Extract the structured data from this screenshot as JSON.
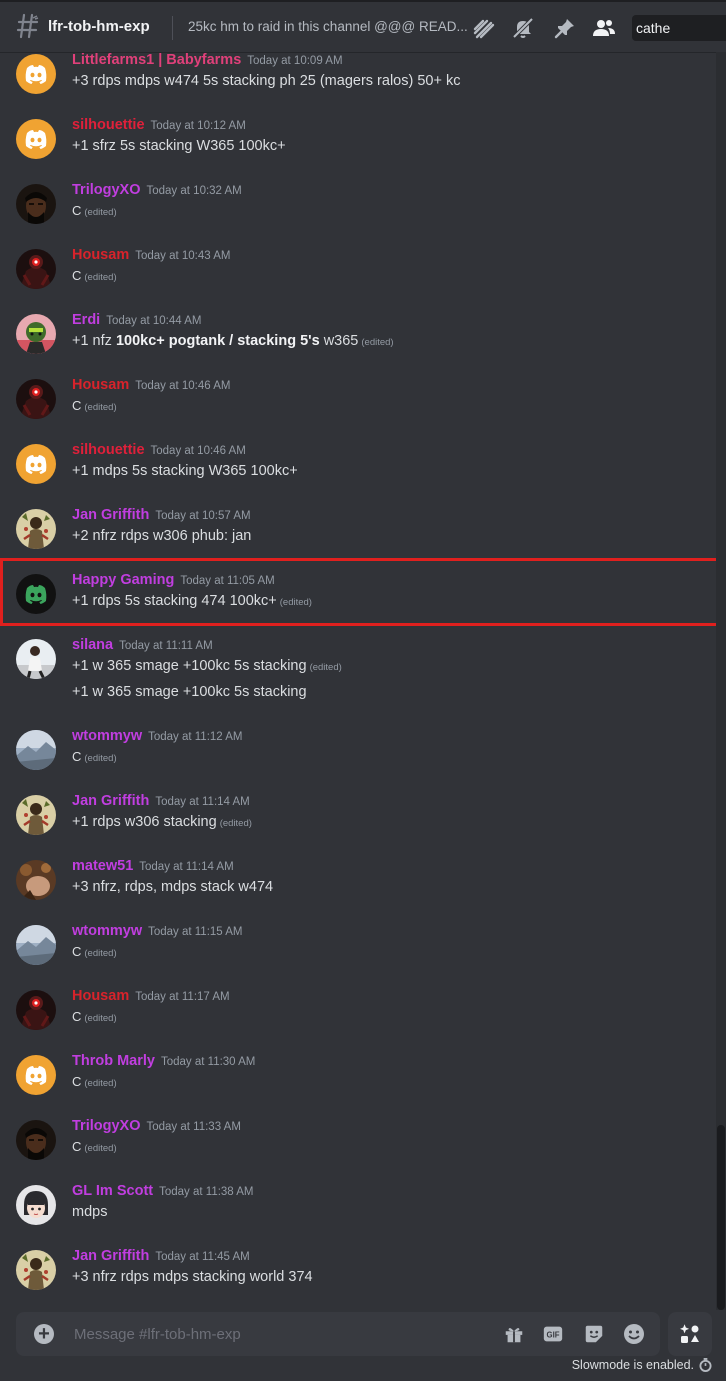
{
  "header": {
    "channel_name": "lfr-tob-hm-exp",
    "topic": "25kc hm to raid in this channel @@@ READ...",
    "search_value": "cathe"
  },
  "messages": [
    {
      "user": "Littlefarms1 | Babyfarms",
      "color": "#e0407a",
      "time": "Today at 10:09 AM",
      "avatar": "discord-orange",
      "lines": [
        {
          "parts": [
            {
              "t": "+3 rdps mdps w474 5s stacking ph 25 (magers ralos) 50+ kc"
            }
          ]
        }
      ]
    },
    {
      "user": "silhouettie",
      "color": "#e0203a",
      "time": "Today at 10:12 AM",
      "avatar": "discord-orange",
      "lines": [
        {
          "parts": [
            {
              "t": "+1 sfrz 5s stacking W365 100kc+"
            }
          ]
        }
      ]
    },
    {
      "user": "TrilogyXO",
      "color": "#c13ee0",
      "time": "Today at 10:32 AM",
      "avatar": "dark-face",
      "lines": [
        {
          "parts": [
            {
              "t": "C",
              "small": true
            }
          ],
          "edited": "(edited)"
        }
      ]
    },
    {
      "user": "Housam",
      "color": "#d8232b",
      "time": "Today at 10:43 AM",
      "avatar": "red-eye",
      "lines": [
        {
          "parts": [
            {
              "t": "C",
              "small": true
            }
          ],
          "edited": "(edited)"
        }
      ]
    },
    {
      "user": "Erdi",
      "color": "#c13ee0",
      "time": "Today at 10:44 AM",
      "avatar": "green-char",
      "lines": [
        {
          "parts": [
            {
              "t": "+1 nfz "
            },
            {
              "t": "100kc+ pogtank / stacking 5's",
              "bold": true
            },
            {
              "t": " w365"
            }
          ],
          "edited": "(edited)"
        }
      ]
    },
    {
      "user": "Housam",
      "color": "#d8232b",
      "time": "Today at 10:46 AM",
      "avatar": "red-eye",
      "lines": [
        {
          "parts": [
            {
              "t": "C",
              "small": true
            }
          ],
          "edited": "(edited)"
        }
      ]
    },
    {
      "user": "silhouettie",
      "color": "#e0203a",
      "time": "Today at 10:46 AM",
      "avatar": "discord-orange",
      "lines": [
        {
          "parts": [
            {
              "t": "+1 mdps 5s stacking W365 100kc+"
            }
          ]
        }
      ]
    },
    {
      "user": "Jan Griffith",
      "color": "#c13ee0",
      "time": "Today at 10:57 AM",
      "avatar": "beige-figure",
      "lines": [
        {
          "parts": [
            {
              "t": "+2 nfrz rdps w306 phub: jan"
            }
          ]
        }
      ]
    },
    {
      "user": "Happy Gaming",
      "color": "#c13ee0",
      "time": "Today at 11:05 AM",
      "avatar": "discord-green",
      "lines": [
        {
          "parts": [
            {
              "t": "+1 rdps 5s stacking 474 100kc+"
            }
          ],
          "edited": "(edited)"
        }
      ]
    },
    {
      "user": "silana",
      "color": "#c13ee0",
      "time": "Today at 11:11 AM",
      "avatar": "person-photo",
      "lines": [
        {
          "parts": [
            {
              "t": "+1 w 365 smage +100kc 5s stacking"
            }
          ],
          "edited": "(edited)"
        },
        {
          "parts": [
            {
              "t": "+1 w 365 smage +100kc 5s stacking"
            }
          ]
        }
      ]
    },
    {
      "user": "wtommyw",
      "color": "#c13ee0",
      "time": "Today at 11:12 AM",
      "avatar": "grey-landscape",
      "lines": [
        {
          "parts": [
            {
              "t": "C",
              "small": true
            }
          ],
          "edited": "(edited)"
        }
      ]
    },
    {
      "user": "Jan Griffith",
      "color": "#c13ee0",
      "time": "Today at 11:14 AM",
      "avatar": "beige-figure",
      "lines": [
        {
          "parts": [
            {
              "t": "+1 rdps w306 stacking"
            }
          ],
          "edited": "(edited)"
        }
      ]
    },
    {
      "user": "matew51",
      "color": "#c13ee0",
      "time": "Today at 11:14 AM",
      "avatar": "brown-photo",
      "lines": [
        {
          "parts": [
            {
              "t": "+3 nfrz, rdps, mdps stack w474"
            }
          ]
        }
      ]
    },
    {
      "user": "wtommyw",
      "color": "#c13ee0",
      "time": "Today at 11:15 AM",
      "avatar": "grey-landscape",
      "lines": [
        {
          "parts": [
            {
              "t": "C",
              "small": true
            }
          ],
          "edited": "(edited)"
        }
      ]
    },
    {
      "user": "Housam",
      "color": "#d8232b",
      "time": "Today at 11:17 AM",
      "avatar": "red-eye",
      "lines": [
        {
          "parts": [
            {
              "t": "C",
              "small": true
            }
          ],
          "edited": "(edited)"
        }
      ]
    },
    {
      "user": "Throb Marly",
      "color": "#c13ee0",
      "time": "Today at 11:30 AM",
      "avatar": "discord-orange",
      "lines": [
        {
          "parts": [
            {
              "t": "C",
              "small": true
            }
          ],
          "edited": "(edited)"
        }
      ]
    },
    {
      "user": "TrilogyXO",
      "color": "#c13ee0",
      "time": "Today at 11:33 AM",
      "avatar": "dark-face",
      "lines": [
        {
          "parts": [
            {
              "t": "C",
              "small": true
            }
          ],
          "edited": "(edited)"
        }
      ]
    },
    {
      "user": "GL Im Scott",
      "color": "#c13ee0",
      "time": "Today at 11:38 AM",
      "avatar": "anime-face",
      "lines": [
        {
          "parts": [
            {
              "t": "mdps"
            }
          ]
        }
      ]
    },
    {
      "user": "Jan Griffith",
      "color": "#c13ee0",
      "time": "Today at 11:45 AM",
      "avatar": "beige-figure",
      "lines": [
        {
          "parts": [
            {
              "t": "+3 nfrz rdps mdps stacking world 374"
            }
          ]
        }
      ]
    }
  ],
  "composer": {
    "placeholder": "Message #lfr-tob-hm-exp",
    "slowmode": "Slowmode is enabled."
  }
}
